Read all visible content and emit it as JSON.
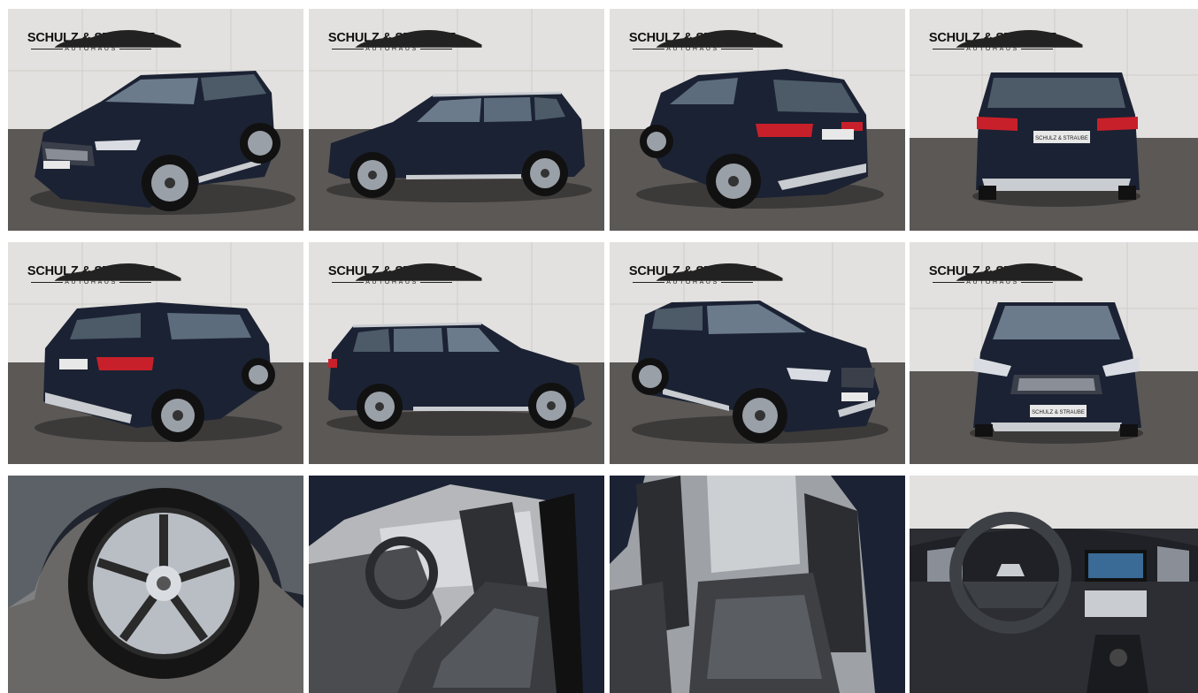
{
  "dealer": {
    "brand": "SCHULZ & STRAUBE",
    "sub": "AUTOHAUS",
    "plate": "SCHULZ & STRAUBE"
  },
  "colors": {
    "car_body": "#1b2233",
    "wall": "#e2e1df",
    "floor": "#5b5856",
    "trim": "#c9ccd0",
    "tail_light": "#c8202a"
  },
  "photos": [
    {
      "view": "front-left-three-quarter"
    },
    {
      "view": "left-side"
    },
    {
      "view": "rear-left-three-quarter"
    },
    {
      "view": "rear"
    },
    {
      "view": "rear-right-three-quarter"
    },
    {
      "view": "right-side"
    },
    {
      "view": "front-right-three-quarter"
    },
    {
      "view": "front"
    },
    {
      "view": "wheel-detail"
    },
    {
      "view": "front-seats"
    },
    {
      "view": "rear-seats"
    },
    {
      "view": "dashboard"
    }
  ]
}
